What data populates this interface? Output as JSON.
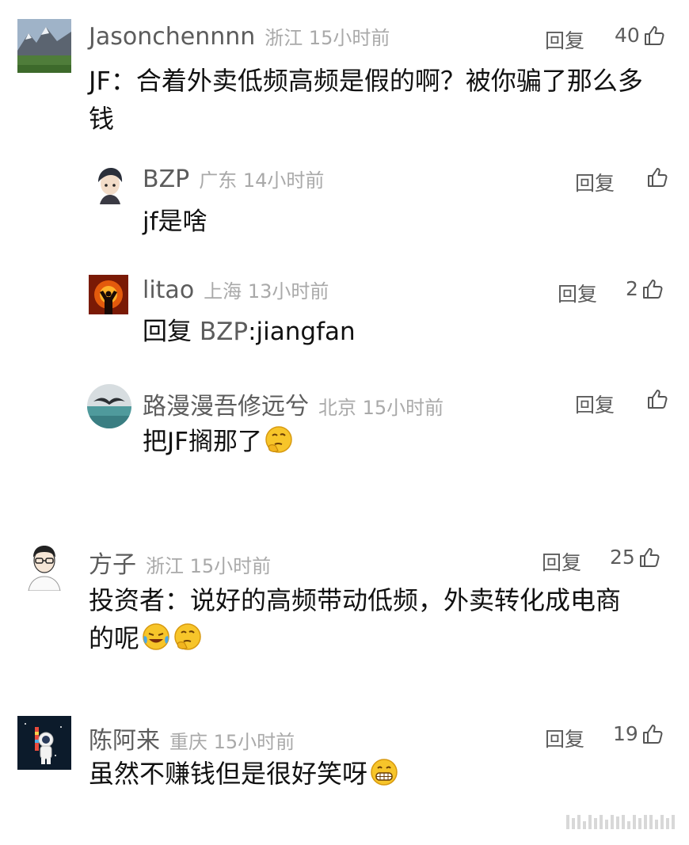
{
  "comments": [
    {
      "username": "Jasonchennnn",
      "location": "浙江",
      "time": "15小时前",
      "reply_label": "回复",
      "likes": "40",
      "text": "JF：合着外卖低频高频是假的啊？被你骗了那么多钱",
      "avatar_icon": "mountain-landscape-avatar",
      "replies": [
        {
          "username": "BZP",
          "location": "广东",
          "time": "14小时前",
          "reply_label": "回复",
          "likes": "",
          "text": "jf是啥",
          "avatar_icon": "anime-boy-avatar"
        },
        {
          "username": "litao",
          "location": "上海",
          "time": "13小时前",
          "reply_label": "回复",
          "likes": "2",
          "text_prefix": "回复",
          "text_target": "BZP",
          "text_sep": ":",
          "text": "jiangfan",
          "avatar_icon": "fire-silhouette-avatar"
        },
        {
          "username": "路漫漫吾修远兮",
          "location": "北京",
          "time": "15小时前",
          "reply_label": "回复",
          "likes": "",
          "text": "把JF搁那了",
          "emoji": [
            "thinking-face-emoji"
          ],
          "avatar_icon": "seagull-sea-avatar"
        }
      ]
    },
    {
      "username": "方子",
      "location": "浙江",
      "time": "15小时前",
      "reply_label": "回复",
      "likes": "25",
      "text_line1": "投资者：说好的高频带动低频，外卖转化成电商",
      "text_line2": "的呢",
      "emoji": [
        "crying-laughing-emoji",
        "thinking-face-emoji"
      ],
      "avatar_icon": "glasses-man-avatar"
    },
    {
      "username": "陈阿来",
      "location": "重庆",
      "time": "15小时前",
      "reply_label": "回复",
      "likes": "19",
      "text": "虽然不赚钱但是很好笑呀",
      "emoji": [
        "grinning-face-emoji"
      ],
      "avatar_icon": "astronaut-avatar"
    }
  ],
  "colors": {
    "username": "#5c5c5c",
    "location": "#a9a9a9",
    "text": "#111111"
  },
  "icons": {
    "like": "thumbs-up-icon",
    "watermark": "barcode-watermark-icon"
  }
}
